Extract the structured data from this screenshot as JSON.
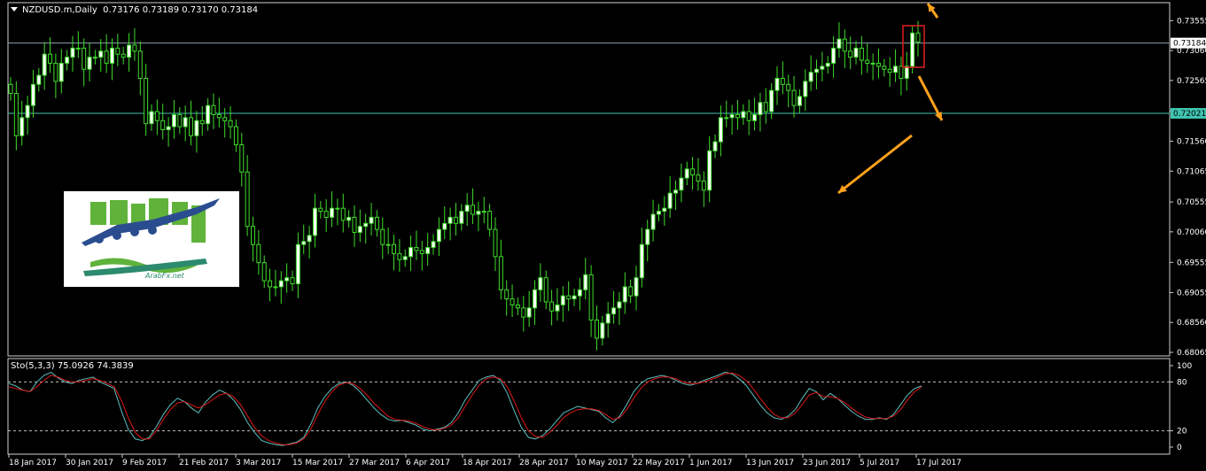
{
  "header": {
    "symbol_label": "NZDUSD.m,Daily",
    "ohlc_values": "0.73176 0.73189 0.73170 0.73184"
  },
  "indicator": {
    "label": "Sto(5,3,3) 75.0926 74.3839",
    "levels": [
      "100",
      "80",
      "20",
      "0"
    ]
  },
  "logo": {
    "site_text": "ArabFx.net",
    "colors": {
      "green": "#5fb33a",
      "blue": "#2a4d8f",
      "teal": "#2c8a6e"
    }
  },
  "price_badges": {
    "current": "0.73184",
    "line": "0.72021"
  },
  "colors": {
    "background": "#000000",
    "bull_candle": "#ffffff",
    "bear_candle": "#000000",
    "candle_wick": "#3fdc2a",
    "stoch_main": "#5fbfbf",
    "stoch_signal": "#e01818",
    "arrow": "#ffa21a",
    "highlight_box": "#e02020",
    "grid_frame": "#ffffff"
  },
  "chart_data": {
    "type": "candlestick",
    "title": "NZDUSD.m,Daily",
    "ylim": [
      0.68065,
      0.7375
    ],
    "y_ticks": [
      "0.73555",
      "0.73060",
      "0.72565",
      "0.72060",
      "0.71560",
      "0.71065",
      "0.70555",
      "0.70060",
      "0.69555",
      "0.69055",
      "0.68560",
      "0.68065"
    ],
    "x_ticks": [
      "18 Jan 2017",
      "30 Jan 2017",
      "9 Feb 2017",
      "21 Feb 2017",
      "3 Mar 2017",
      "15 Mar 2017",
      "27 Mar 2017",
      "6 Apr 2017",
      "18 Apr 2017",
      "28 Apr 2017",
      "10 May 2017",
      "22 May 2017",
      "1 Jun 2017",
      "13 Jun 2017",
      "23 Jun 2017",
      "5 Jul 2017",
      "17 Jul 2017"
    ],
    "candle_closes": [
      0.7235,
      0.7165,
      0.7195,
      0.7215,
      0.725,
      0.7265,
      0.73,
      0.7285,
      0.7255,
      0.7285,
      0.7295,
      0.731,
      0.731,
      0.7275,
      0.7295,
      0.7295,
      0.7305,
      0.7285,
      0.731,
      0.73,
      0.7295,
      0.7315,
      0.7305,
      0.726,
      0.7185,
      0.7205,
      0.719,
      0.7175,
      0.718,
      0.72,
      0.718,
      0.7195,
      0.7165,
      0.719,
      0.7185,
      0.7215,
      0.72,
      0.7195,
      0.719,
      0.718,
      0.715,
      0.7105,
      0.7015,
      0.6985,
      0.6955,
      0.6925,
      0.6915,
      0.6915,
      0.6925,
      0.693,
      0.692,
      0.6985,
      0.699,
      0.7,
      0.7045,
      0.704,
      0.703,
      0.7045,
      0.7045,
      0.7025,
      0.703,
      0.7005,
      0.7015,
      0.702,
      0.703,
      0.701,
      0.6985,
      0.6985,
      0.697,
      0.696,
      0.6965,
      0.698,
      0.6975,
      0.697,
      0.698,
      0.699,
      0.701,
      0.702,
      0.703,
      0.702,
      0.704,
      0.705,
      0.7035,
      0.704,
      0.704,
      0.701,
      0.6965,
      0.691,
      0.6895,
      0.6885,
      0.688,
      0.6865,
      0.688,
      0.691,
      0.693,
      0.689,
      0.6875,
      0.6885,
      0.69,
      0.6895,
      0.69,
      0.691,
      0.6935,
      0.686,
      0.683,
      0.6855,
      0.687,
      0.688,
      0.689,
      0.6915,
      0.69,
      0.693,
      0.6985,
      0.701,
      0.7035,
      0.704,
      0.7045,
      0.707,
      0.7075,
      0.7095,
      0.711,
      0.71,
      0.709,
      0.7075,
      0.714,
      0.7155,
      0.7195,
      0.7195,
      0.72,
      0.7195,
      0.7205,
      0.719,
      0.72,
      0.722,
      0.7205,
      0.724,
      0.726,
      0.725,
      0.724,
      0.7215,
      0.723,
      0.7255,
      0.727,
      0.7275,
      0.728,
      0.7285,
      0.731,
      0.7325,
      0.7305,
      0.7295,
      0.731,
      0.729,
      0.7285,
      0.7285,
      0.728,
      0.7275,
      0.727,
      0.728,
      0.726,
      0.728,
      0.7335,
      0.732
    ],
    "stochastic": {
      "main_values": [
        78,
        75,
        70,
        68,
        80,
        88,
        92,
        85,
        80,
        78,
        82,
        84,
        86,
        80,
        76,
        72,
        45,
        22,
        10,
        8,
        12,
        25,
        40,
        52,
        60,
        56,
        48,
        42,
        55,
        64,
        70,
        66,
        58,
        46,
        30,
        18,
        8,
        5,
        3,
        2,
        4,
        6,
        12,
        28,
        48,
        62,
        72,
        78,
        80,
        76,
        68,
        58,
        48,
        40,
        34,
        32,
        33,
        30,
        27,
        22,
        20,
        22,
        24,
        30,
        42,
        58,
        70,
        82,
        86,
        88,
        82,
        66,
        44,
        24,
        12,
        10,
        14,
        22,
        32,
        42,
        46,
        50,
        48,
        46,
        44,
        36,
        30,
        38,
        52,
        68,
        78,
        84,
        86,
        88,
        86,
        82,
        78,
        76,
        78,
        82,
        85,
        88,
        92,
        90,
        84,
        76,
        64,
        52,
        42,
        36,
        34,
        38,
        46,
        60,
        72,
        68,
        58,
        66,
        60,
        52,
        44,
        38,
        34,
        34,
        36,
        34,
        40,
        52,
        64,
        72,
        75
      ],
      "signal_values": [
        74,
        72,
        70,
        68,
        74,
        82,
        88,
        86,
        82,
        80,
        80,
        82,
        84,
        82,
        78,
        74,
        58,
        36,
        18,
        10,
        10,
        20,
        34,
        46,
        54,
        56,
        52,
        48,
        52,
        58,
        64,
        66,
        62,
        52,
        38,
        24,
        14,
        8,
        5,
        3,
        3,
        5,
        10,
        22,
        40,
        56,
        68,
        76,
        79,
        78,
        72,
        64,
        54,
        46,
        38,
        34,
        33,
        32,
        29,
        25,
        22,
        21,
        23,
        27,
        36,
        50,
        64,
        76,
        84,
        86,
        84,
        74,
        56,
        36,
        20,
        13,
        12,
        18,
        26,
        36,
        42,
        46,
        47,
        47,
        45,
        40,
        34,
        36,
        46,
        60,
        72,
        80,
        84,
        86,
        86,
        84,
        80,
        78,
        78,
        80,
        83,
        86,
        90,
        91,
        88,
        82,
        72,
        60,
        49,
        40,
        36,
        36,
        42,
        52,
        64,
        67,
        62,
        62,
        60,
        55,
        48,
        42,
        37,
        35,
        35,
        35,
        38,
        46,
        58,
        68,
        74
      ]
    }
  }
}
